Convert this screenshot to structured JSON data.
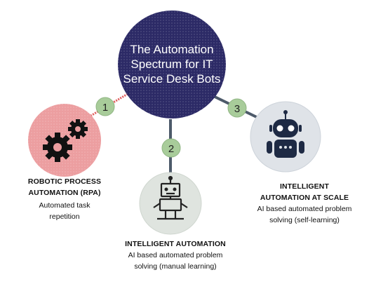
{
  "center": {
    "title": "The Automation Spectrum for IT Service Desk Bots",
    "color": "#2c2a66"
  },
  "stages": [
    {
      "number": "1",
      "title": "ROBOTIC PROCESS AUTOMATION (RPA)",
      "description": "Automated task repetition",
      "icon": "gears-icon",
      "circle_color": "#ec9ea0",
      "connector_color": "#e05a5a"
    },
    {
      "number": "2",
      "title": "INTELLIGENT AUTOMATION",
      "description": "AI based automated problem solving (manual learning)",
      "icon": "robot-icon",
      "circle_color": "#dfe4df",
      "connector_color": "#4d5a6a"
    },
    {
      "number": "3",
      "title": "INTELLIGENT AUTOMATION AT SCALE",
      "description": "AI based automated problem solving (self-learning)",
      "icon": "ai-robot-icon",
      "circle_color": "#dfe3e8",
      "connector_color": "#4d5a6a"
    }
  ],
  "badge_color": "#a8cc9a"
}
